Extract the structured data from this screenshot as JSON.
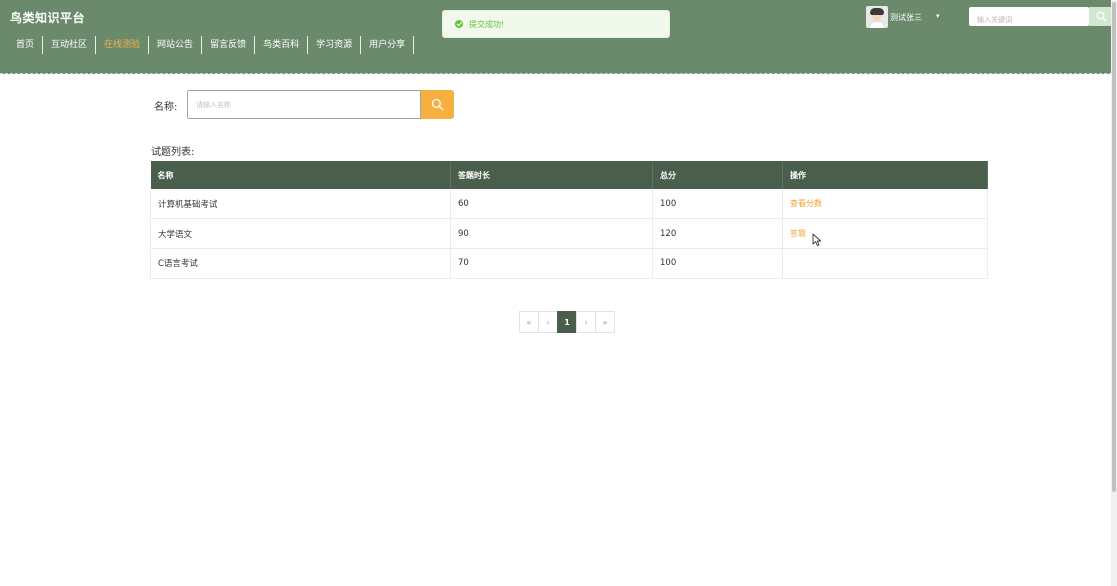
{
  "header": {
    "brand": "鸟类知识平台",
    "nav": [
      {
        "label": "首页",
        "active": false
      },
      {
        "label": "互动社区",
        "active": false
      },
      {
        "label": "在线测验",
        "active": true
      },
      {
        "label": "网站公告",
        "active": false
      },
      {
        "label": "留言反馈",
        "active": false
      },
      {
        "label": "鸟类百科",
        "active": false
      },
      {
        "label": "学习资源",
        "active": false
      },
      {
        "label": "用户分享",
        "active": false
      }
    ],
    "username": "测试张三",
    "search_placeholder": "输入关键词"
  },
  "toast": {
    "message": "提交成功!",
    "color": "#67c23a"
  },
  "filter": {
    "label": "名称:",
    "placeholder": "请输入名称",
    "value": ""
  },
  "table": {
    "title": "试题列表:",
    "columns": [
      "名称",
      "答题时长",
      "总分",
      "操作"
    ],
    "rows": [
      {
        "name": "计算机基础考试",
        "duration": "60",
        "total": "100",
        "action": "查看分数"
      },
      {
        "name": "大学语文",
        "duration": "90",
        "total": "120",
        "action": "答题"
      },
      {
        "name": "C语言考试",
        "duration": "70",
        "total": "100",
        "action": ""
      }
    ]
  },
  "pagination": {
    "first": "«",
    "prev": "‹",
    "current": "1",
    "next": "›",
    "last": "»"
  },
  "colors": {
    "header_bg": "#6b8a6c",
    "table_header_bg": "#4a5e4c",
    "accent": "#f5b041",
    "active_nav": "#f4b04a"
  }
}
